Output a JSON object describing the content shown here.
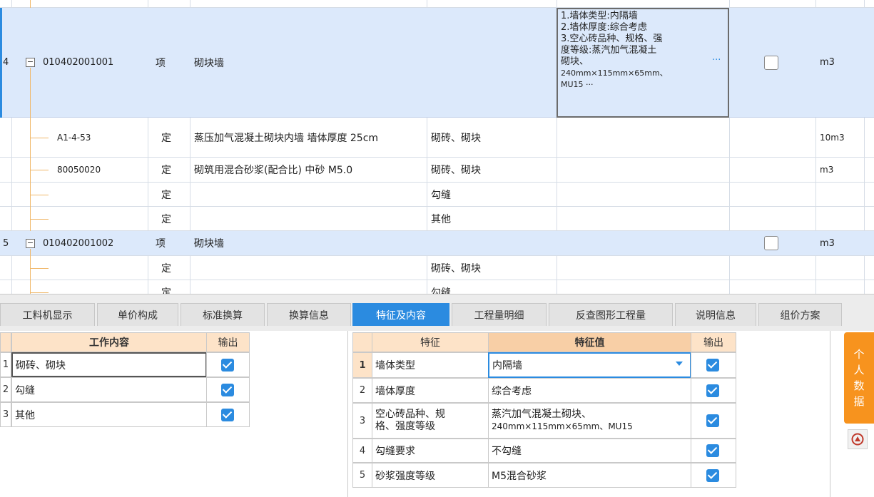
{
  "grid": {
    "rows": [
      {
        "num": "4",
        "code": "010402001001",
        "type": "项",
        "name": "砌块墙",
        "content": "",
        "unit": "m3"
      },
      {
        "num": "",
        "code": "A1-4-53",
        "type": "定",
        "name": "蒸压加气混凝土砌块内墙 墙体厚度 25cm",
        "content": "砌砖、砌块",
        "unit": "10m3"
      },
      {
        "num": "",
        "code": "80050020",
        "type": "定",
        "name": "砌筑用混合砂浆(配合比) 中砂 M5.0",
        "content": "砌砖、砌块",
        "unit": "m3"
      },
      {
        "num": "",
        "code": "",
        "type": "定",
        "name": "",
        "content": "勾缝",
        "unit": ""
      },
      {
        "num": "",
        "code": "",
        "type": "定",
        "name": "",
        "content": "其他",
        "unit": ""
      },
      {
        "num": "5",
        "code": "010402001002",
        "type": "项",
        "name": "砌块墙",
        "content": "",
        "unit": "m3"
      },
      {
        "num": "",
        "code": "",
        "type": "定",
        "name": "",
        "content": "砌砖、砌块",
        "unit": ""
      },
      {
        "num": "",
        "code": "",
        "type": "定",
        "name": "",
        "content": "勾缝",
        "unit": ""
      }
    ],
    "feature_lines": [
      "1.墙体类型:内隔墙",
      "2.墙体厚度:综合考虑",
      "3.空心砖品种、规格、强",
      "度等级:蒸汽加气混凝土",
      "砌块、",
      "240mm×115mm×65mm、",
      "MU15  ···"
    ],
    "feature_more": "···"
  },
  "tabs": [
    "工料机显示",
    "单价构成",
    "标准换算",
    "换算信息",
    "特征及内容",
    "工程量明细",
    "反查图形工程量",
    "说明信息",
    "组价方案"
  ],
  "active_tab": "特征及内容",
  "work_panel": {
    "header": "工作内容",
    "output_header": "输出",
    "rows": [
      {
        "num": "1",
        "text": "砌砖、砌块",
        "checked": true
      },
      {
        "num": "2",
        "text": "勾缝",
        "checked": true
      },
      {
        "num": "3",
        "text": "其他",
        "checked": true
      }
    ]
  },
  "feature_panel": {
    "feature_header": "特征",
    "value_header": "特征值",
    "output_header": "输出",
    "rows": [
      {
        "num": "1",
        "feature": "墙体类型",
        "value": "内隔墙",
        "checked": true
      },
      {
        "num": "2",
        "feature": "墙体厚度",
        "value": "综合考虑",
        "checked": true
      },
      {
        "num": "3",
        "feature": "空心砖品种、规格、强度等级",
        "value": "蒸汽加气混凝土砌块、240mm×115mm×65mm、MU15",
        "checked": true
      },
      {
        "num": "4",
        "feature": "勾缝要求",
        "value": "不勾缝",
        "checked": true
      },
      {
        "num": "5",
        "feature": "砂浆强度等级",
        "value": "M5混合砂浆",
        "checked": true
      }
    ],
    "row3_feature_lines": [
      "空心砖品种、规",
      "格、强度等级"
    ],
    "row3_value_lines": [
      "蒸汽加气混凝土砌块、",
      "240mm×115mm×65mm、MU15"
    ]
  },
  "side_button": {
    "chars": [
      "个",
      "人",
      "数",
      "据"
    ]
  },
  "colors": {
    "accent": "#2b8be0",
    "row_highlight": "#dce9fb",
    "header_bg": "#fde3c8",
    "side_button": "#f7931e"
  }
}
